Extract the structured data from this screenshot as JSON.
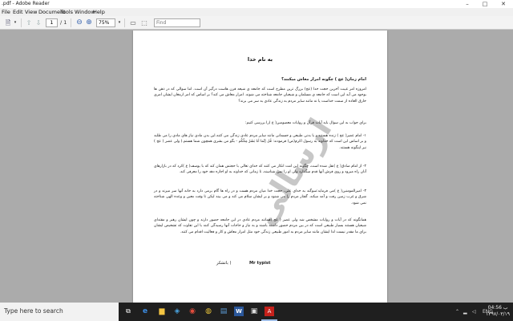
{
  "window": {
    "title": ".pdf - Adobe Reader"
  },
  "menu": [
    "File",
    "Edit",
    "View",
    "Document",
    "Tools",
    "Window",
    "Help"
  ],
  "toolbar": {
    "current_page": "1",
    "page_total": "/ 1",
    "zoom": "75%",
    "find_placeholder": "Find"
  },
  "document": {
    "heading": "به نام خدا",
    "question_title": "امام زمان( عج ) چگونه امرار معاش میکنند؟",
    "para1": "امروزه امر غیبت آخرین حجت خدا (عج) بزرگ ترین مطرح است که جامعه ی شیعه قرن هاست درگیر آن است. اما سوالی که در ذهن ها بوجود می آید این است که جامعه ی مسلمان و شیعیان جامعه شناخته می شوند. امرار معاش می کند؟ بر اساس که امر ارمغان ایشان امری خارق العاده از سمت خداست یا نه مانند سایر مردم به زندگی عادی به سر می برند؟",
    "para2": "برای جواب به این سوال باید آیات قرآن و روایات معصومین( ع )را بررسی کنیم:",
    "item1": "۱- امام عصر( عج ) زنده هستند و با بدنی طبیعی و جسمانی مانند سایر مردم عادی زندگی می کنند.این بدن مادی نیاز های مادی را می طلبد و بر اساس این است که خداوند به رسول اکرم(ص) فرمودند: قُل إنّما أنا بَشَرٌ مِثلُکُم - بگو من بشری همچون شما هستم.) ولی عصر ( عج ) نیز اینگونه هستند.",
    "item2": "۲- از امام صادق( ع )نقل شده است، چگونه این امت انکار می کنند که خدای تعالی با حجتش همان کند که با یوسف( ع )کرد که در بازارهای آنان راه میرود و روی فرش آنها قدم میگذارد ولی او را نمی شناسند، تا زمانی که خداوند به او اجازه دهد خود را معرفی کند.",
    "item3": "۳- امیرالمومنین( ع )می فرماید:سوگند به خدای علی، حجت خدا میان مردم هست و در راه ها گام برمی دارد به خانه آنها سر میزند و در شرق و غرب زمین رفت و آمد میکند. گفتار مردم را می شنود و بر ایشان سلام می کند و می بیند لیکن تا وقت معین و وعده الهی شناخته نمی شود.",
    "para3": "همانگونه که در آیات و روایات مشخص شد ولی عصر ( عج )همانند مردم عادی در این جامعه حضور دارند و چون ایشان رهبر و مقتدای شیعیان هستند بسیار طبیعی است که در بین مردم حضور داشته باشند و به نیاز و حاجات آنها رسیدگی کنند با این تفاوت که تشخیص ایشان برای ما مقدر نیست لذا ایشان مانند سایر مردم به امور طبیعی زندگی خود مثل امرار معاش و کار و فعالیت اقدام می کنند.",
    "signature_name": "Mr typist",
    "signature_label": "باتشکر )"
  },
  "watermark": "ارسالی",
  "taskbar": {
    "search_placeholder": "Type here to search",
    "language": "ENG",
    "time": "04:56 ب",
    "date": "۱۳۹۷/۰۳/۱۹"
  },
  "colors": {
    "taskbar_bg": "#1f1f1f",
    "viewer_bg": "#ababab",
    "accent": "#3a66b0"
  }
}
